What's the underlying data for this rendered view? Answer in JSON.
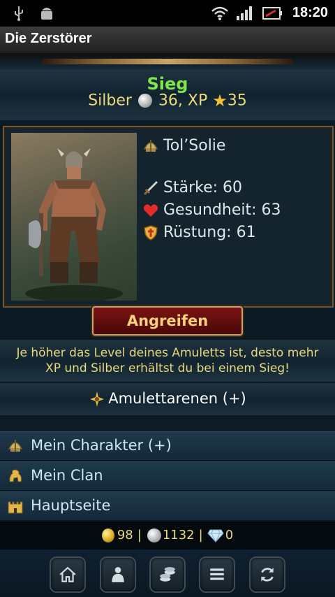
{
  "status_bar": {
    "time": "18:20"
  },
  "app": {
    "title": "Die Zerstörer"
  },
  "result": {
    "heading": "Sieg",
    "rewards": {
      "silver_label": "Silber",
      "silver_amount": "36, XP",
      "xp_amount": "35"
    }
  },
  "opponent": {
    "name": "Tol’Solie",
    "stats": [
      {
        "label": "Stärke: 60",
        "icon": "sword-icon"
      },
      {
        "label": "Gesundheit: 63",
        "icon": "heart-icon"
      },
      {
        "label": "Rüstung: 61",
        "icon": "shield-icon"
      }
    ]
  },
  "actions": {
    "attack_label": "Angreifen"
  },
  "hint": {
    "text": "Je höher das Level deines Amuletts ist, desto mehr XP und Silber erhältst du bei einem Sieg!"
  },
  "arena": {
    "label": "Amulettarenen (+)"
  },
  "menu": {
    "items": [
      {
        "label": "Mein Charakter (+)",
        "icon": "helmet-icon"
      },
      {
        "label": "Mein Clan",
        "icon": "lion-icon"
      },
      {
        "label": "Hauptseite",
        "icon": "castle-icon"
      }
    ]
  },
  "currency": {
    "gold": "98",
    "silver": "1132",
    "diamonds": "0",
    "separator": "|"
  },
  "bottom_nav": [
    "home-icon",
    "profile-icon",
    "coins-icon",
    "list-icon",
    "refresh-icon"
  ],
  "colors": {
    "victory": "#7ee84a",
    "gold_text": "#e8d97a",
    "attack_button": "#7a1414"
  }
}
